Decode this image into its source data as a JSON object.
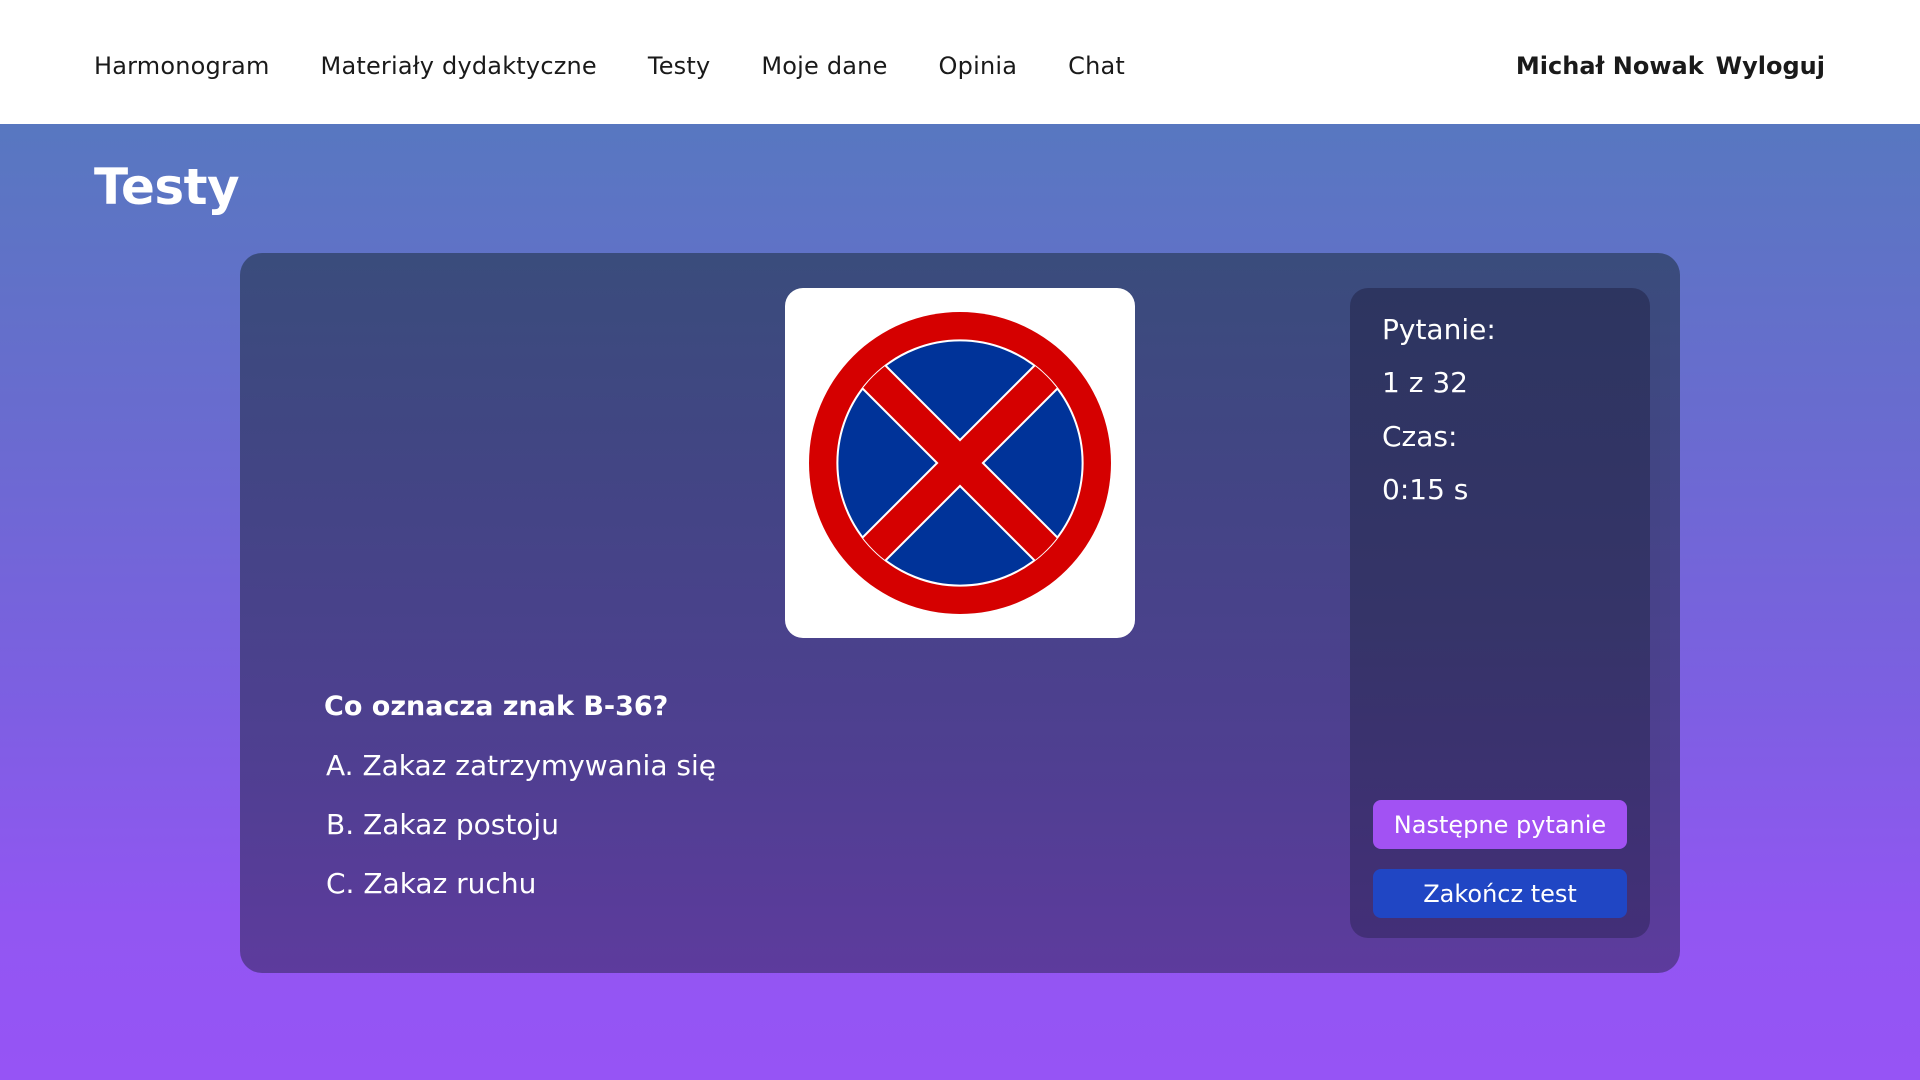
{
  "nav": {
    "items": [
      {
        "label": "Harmonogram"
      },
      {
        "label": "Materiały dydaktyczne"
      },
      {
        "label": "Testy"
      },
      {
        "label": "Moje dane"
      },
      {
        "label": "Opinia"
      },
      {
        "label": "Chat"
      }
    ]
  },
  "user": {
    "name": "Michał Nowak",
    "logout_label": "Wyloguj"
  },
  "page": {
    "title": "Testy"
  },
  "quiz": {
    "question": "Co oznacza znak B-36?",
    "answers": [
      {
        "label": "A. Zakaz zatrzymywania się"
      },
      {
        "label": "B. Zakaz postoju"
      },
      {
        "label": "C. Zakaz ruchu"
      }
    ],
    "sign_icon": "no-stopping-sign-icon"
  },
  "panel": {
    "question_label": "Pytanie:",
    "question_value": "1 z 32",
    "time_label": "Czas:",
    "time_value": "0:15 s",
    "next_label": "Następne pytanie",
    "end_label": "Zakończ test"
  },
  "colors": {
    "sign_red": "#d50000",
    "sign_blue": "#003399",
    "next_button": "#a252f3",
    "end_button": "#2046c4"
  }
}
